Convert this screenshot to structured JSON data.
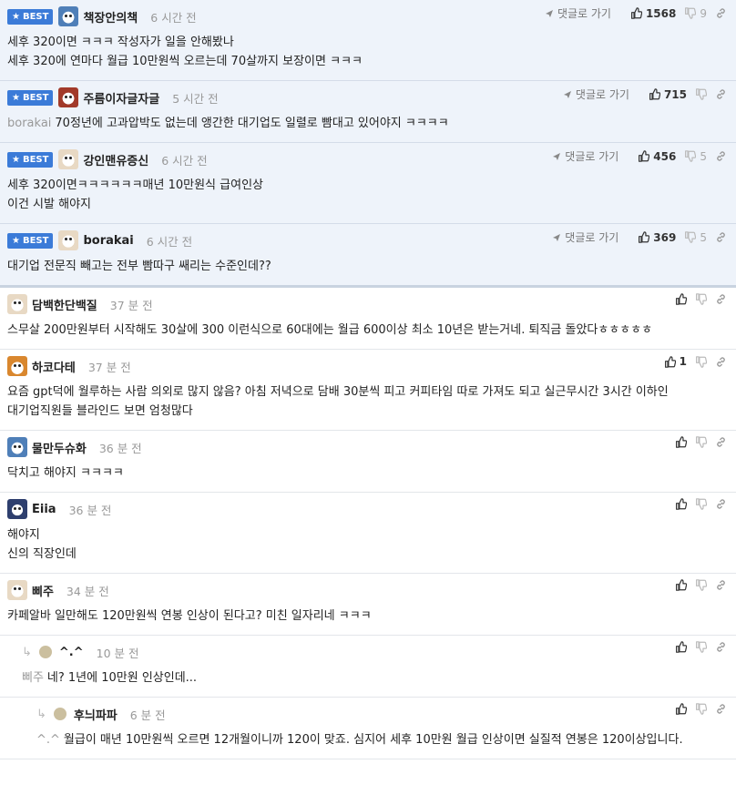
{
  "ui": {
    "best_label": "BEST",
    "goto_label": "댓글로 가기"
  },
  "best_comments": [
    {
      "avatar": "avatar-blue",
      "name": "책장안의책",
      "time": "6 시간 전",
      "likes": "1568",
      "dislikes": "9",
      "lines": [
        "세후 320이면 ㅋㅋㅋ 작성자가 일을 안해봤나",
        "세후 320에 연마다 월급 10만원씩 오르는데 70살까지 보장이면 ㅋㅋㅋ"
      ]
    },
    {
      "avatar": "avatar-red",
      "name": "주름이자글자글",
      "time": "5 시간 전",
      "likes": "715",
      "dislikes": "",
      "mention": "borakai",
      "lines": [
        "70정년에 고과압박도 없는데 앵간한 대기업도 일렬로 빰대고 있어야지 ㅋㅋㅋㅋ"
      ]
    },
    {
      "avatar": "avatar-dog",
      "name": "강인맨유증신",
      "time": "6 시간 전",
      "likes": "456",
      "dislikes": "5",
      "lines": [
        "세후 320이면ㅋㅋㅋㅋㅋㅋ매년 10만원식 급여인상",
        "이건 시발 해야지"
      ]
    },
    {
      "avatar": "avatar-dog",
      "name": "borakai",
      "time": "6 시간 전",
      "likes": "369",
      "dislikes": "5",
      "lines": [
        "대기업 전문직 빼고는 전부 빰따구 쌔리는 수준인데??"
      ]
    }
  ],
  "comments": [
    {
      "avatar": "avatar-dog",
      "name": "담백한단백질",
      "time": "37 분 전",
      "likes": "",
      "lines": [
        "스무살 200만원부터 시작해도 30살에 300 이런식으로 60대에는 월급 600이상 최소 10년은 받는거네. 퇴직금 돌았다ㅎㅎㅎㅎㅎ"
      ]
    },
    {
      "avatar": "avatar-fox",
      "name": "하코다테",
      "time": "37 분 전",
      "likes": "1",
      "lines": [
        "요즘 gpt덕에 월루하는 사람 의외로 많지 않음? 아침 저녁으로 담배 30분씩 피고 커피타임 따로 가져도 되고 실근무시간 3시간 이하인",
        "대기업직원들 블라인드 보면 엄청많다"
      ]
    },
    {
      "avatar": "avatar-blue",
      "name": "물만두슈화",
      "time": "36 분 전",
      "likes": "",
      "lines": [
        "닥치고 해야지 ㅋㅋㅋㅋ"
      ]
    },
    {
      "avatar": "avatar-dark",
      "name": "Eiia",
      "time": "36 분 전",
      "likes": "",
      "lines": [
        "해야지",
        "신의 직장인데"
      ]
    },
    {
      "avatar": "avatar-dog",
      "name": "삐주",
      "time": "34 분 전",
      "likes": "",
      "lines": [
        "카페알바 일만해도 120만원씩 연봉 인상이 된다고? 미친 일자리네 ㅋㅋㅋ"
      ]
    }
  ],
  "replies": [
    {
      "name": "^.^",
      "time": "10 분 전",
      "mention": "삐주",
      "lines": [
        "네? 1년에 10만원 인상인데..."
      ]
    },
    {
      "name": "후늬파파",
      "time": "6 분 전",
      "mention": "^.^",
      "lines": [
        "월급이 매년 10만원씩 오르면 12개월이니까 120이 맞죠. 심지어 세후 10만원 월급 인상이면 실질적 연봉은 120이상입니다."
      ]
    }
  ]
}
